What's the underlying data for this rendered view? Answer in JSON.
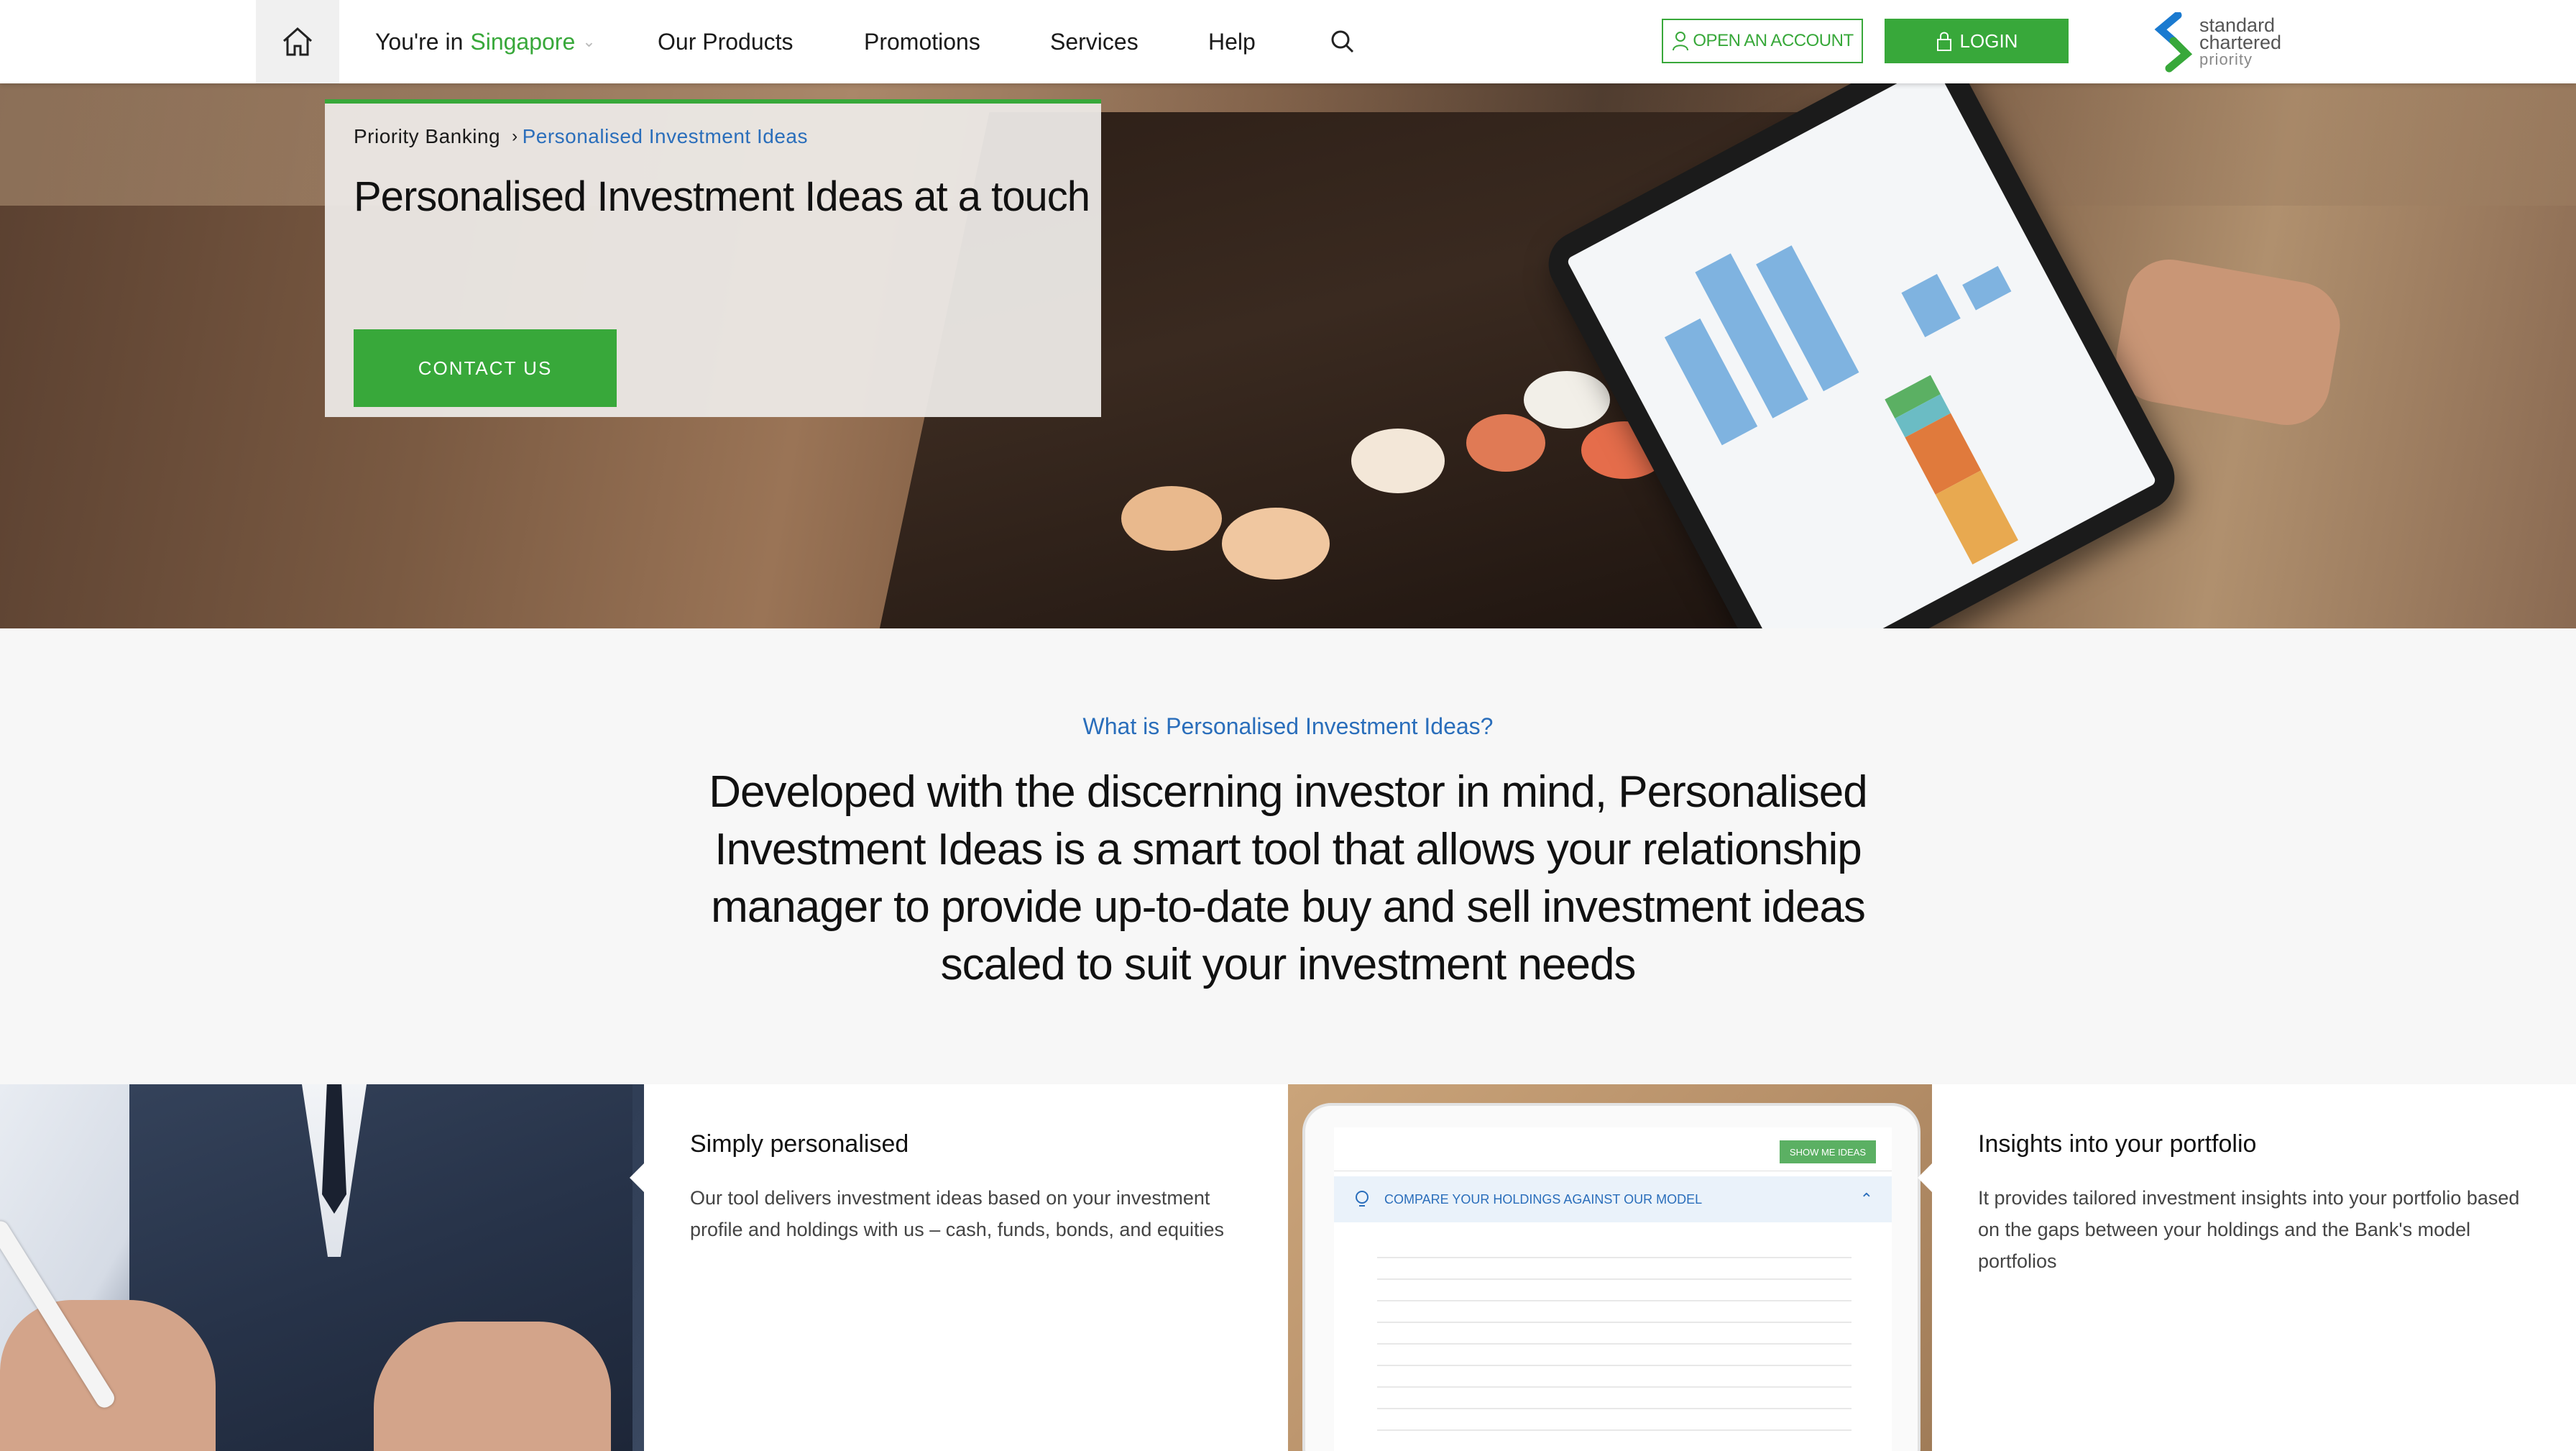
{
  "header": {
    "location_prefix": "You're in",
    "location_value": "Singapore",
    "nav": [
      "Our Products",
      "Promotions",
      "Services",
      "Help"
    ],
    "open_account_label": "OPEN AN ACCOUNT",
    "login_label": "LOGIN",
    "logo_lines": [
      "standard",
      "chartered",
      "priority"
    ]
  },
  "hero": {
    "breadcrumb_root": "Priority Banking",
    "breadcrumb_current": "Personalised Investment Ideas",
    "title": "Personalised Investment Ideas at a touch",
    "cta_label": "CONTACT US"
  },
  "intro": {
    "question": "What is Personalised Investment Ideas?",
    "text": "Developed with the discerning investor in mind, Personalised Investment Ideas is a smart tool that allows your relationship manager to provide up-to-date buy and sell investment ideas scaled to suit your investment needs"
  },
  "features": [
    {
      "title": "Simply personalised",
      "body": "Our tool delivers investment ideas based on your investment profile and holdings with us – cash, funds, bonds, and equities"
    },
    {
      "title": "Insights into your portfolio",
      "body": "It provides tailored investment insights into your portfolio based on the gaps between your holdings and the Bank's model portfolios"
    }
  ],
  "mini_screen": {
    "show_me_label": "SHOW ME IDEAS",
    "compare_label": "COMPARE YOUR HOLDINGS AGAINST OUR MODEL"
  },
  "colors": {
    "brand_green": "#38a83a",
    "link_blue": "#2a6ebb"
  }
}
